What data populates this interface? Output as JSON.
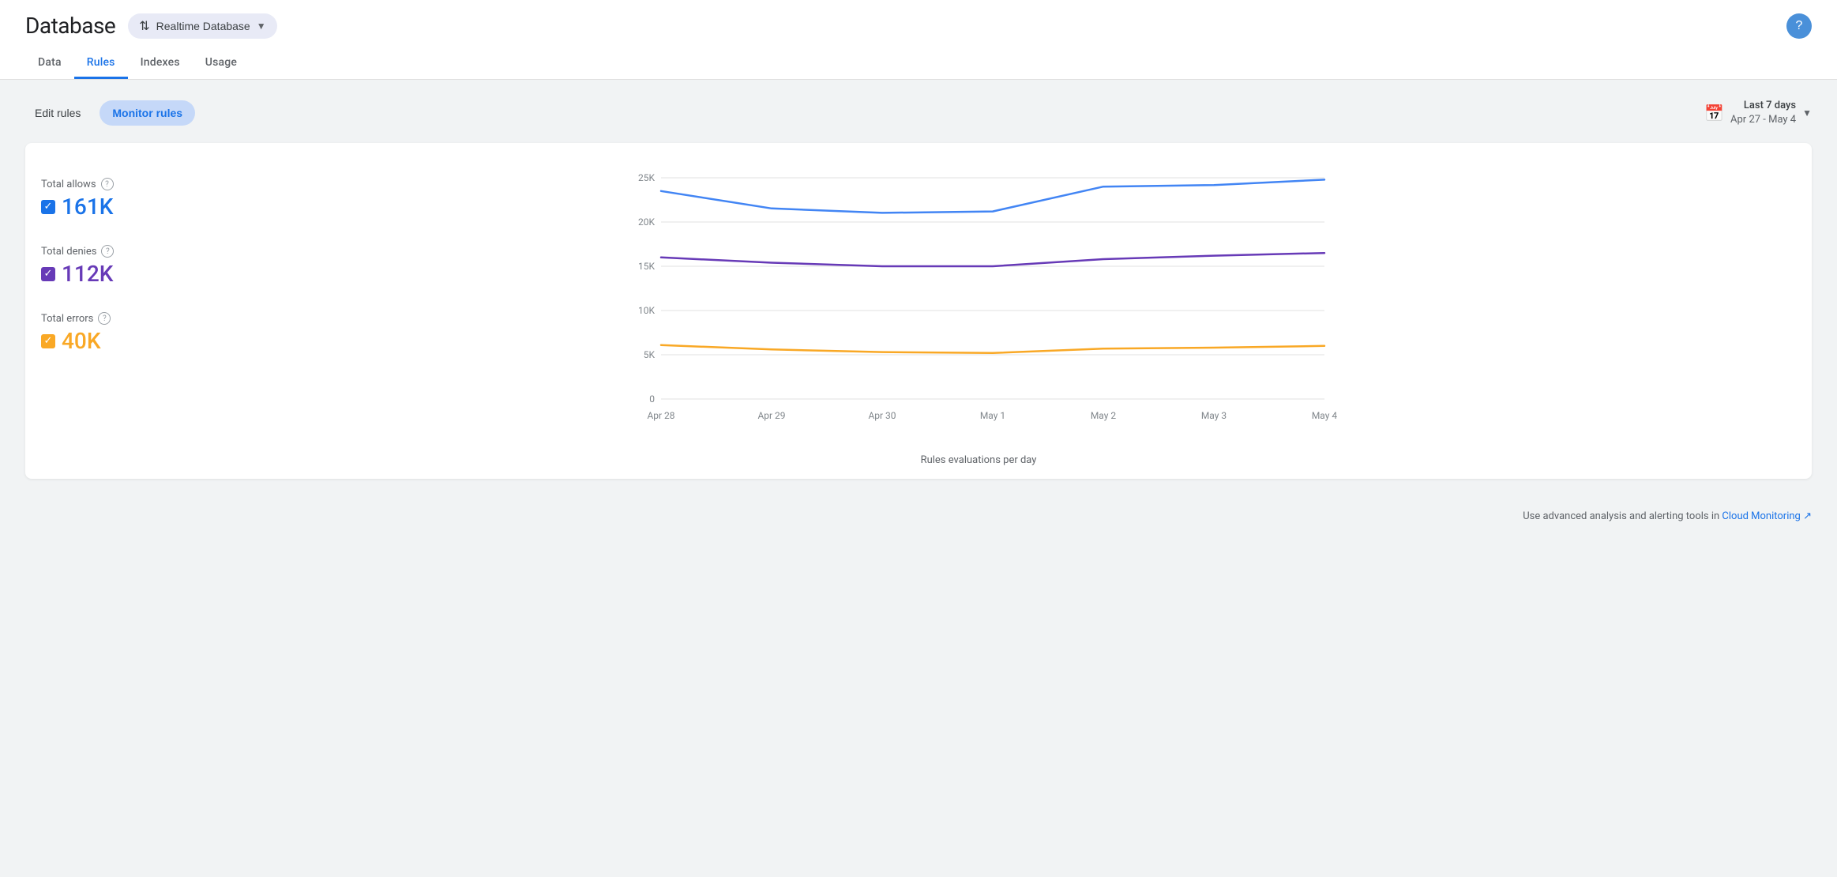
{
  "header": {
    "title": "Database",
    "db_selector_label": "Realtime Database",
    "help_icon": "?"
  },
  "nav": {
    "tabs": [
      {
        "id": "data",
        "label": "Data",
        "active": false
      },
      {
        "id": "rules",
        "label": "Rules",
        "active": true
      },
      {
        "id": "indexes",
        "label": "Indexes",
        "active": false
      },
      {
        "id": "usage",
        "label": "Usage",
        "active": false
      }
    ]
  },
  "toolbar": {
    "edit_rules_label": "Edit rules",
    "monitor_rules_label": "Monitor rules",
    "date_range_label": "Last 7 days",
    "date_range_value": "Apr 27 - May 4"
  },
  "legend": {
    "allows": {
      "label": "Total allows",
      "value": "161K",
      "color": "blue"
    },
    "denies": {
      "label": "Total denies",
      "value": "112K",
      "color": "purple"
    },
    "errors": {
      "label": "Total errors",
      "value": "40K",
      "color": "yellow"
    }
  },
  "chart": {
    "y_labels": [
      "25K",
      "20K",
      "15K",
      "10K",
      "5K",
      "0"
    ],
    "x_labels": [
      "Apr 28",
      "Apr 29",
      "Apr 30",
      "May 1",
      "May 2",
      "May 3",
      "May 4"
    ],
    "x_axis_label": "Rules evaluations per day",
    "blue_line": [
      23500,
      21500,
      21000,
      21200,
      24000,
      24200,
      24800
    ],
    "purple_line": [
      16000,
      15400,
      15000,
      15000,
      15800,
      16200,
      16500
    ],
    "yellow_line": [
      6100,
      5600,
      5300,
      5200,
      5700,
      5800,
      6000
    ]
  },
  "footer": {
    "note": "Use advanced analysis and alerting tools in",
    "link_label": "Cloud Monitoring",
    "external_icon": "↗"
  }
}
